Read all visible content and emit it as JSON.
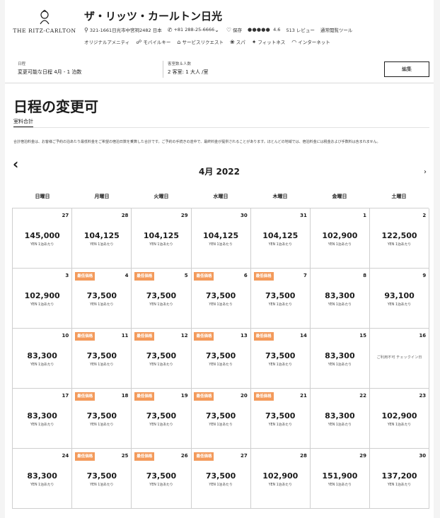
{
  "hotel": {
    "logo_text": "THE RITZ-CARLTON",
    "name": "ザ・リッツ・カールトン日光",
    "address": "321-1661日光市中宮祠2482 日本",
    "phone": "+81 288-25-6666",
    "save_label": "保存",
    "rating_dots": "●●●●●",
    "rating": "4.6",
    "reviews": "513 レビュー",
    "tab_detail": "通常閲覧ツール"
  },
  "amenities": [
    {
      "icon": "gift-icon",
      "glyph": "",
      "label": "オリジナルアメニティ"
    },
    {
      "icon": "mobile-key-icon",
      "glyph": "☍",
      "label": "モバイルキー"
    },
    {
      "icon": "service-bell-icon",
      "glyph": "⌂",
      "label": "サービスリクエスト"
    },
    {
      "icon": "spa-icon",
      "glyph": "❀",
      "label": "スパ"
    },
    {
      "icon": "fitness-icon",
      "glyph": "✦",
      "label": "フィットネス"
    },
    {
      "icon": "wifi-icon",
      "glyph": "◠",
      "label": "インターネット"
    }
  ],
  "search": {
    "date_label": "日程",
    "date_value": "変更可能な日程 4月 - 1 泊数",
    "guests_label": "客室数＆人数",
    "guests_value": "2 客室: 1 大人 /室",
    "edit_label": "編集"
  },
  "page": {
    "title": "日程の変更可",
    "tab": "室料合計",
    "note": "合計宿泊料金は、お客様ご予約の泊あたり最低料金をご希望の宿泊日数を乗算した合計です。ご予約の手続きの途中で、最終料金が提供されることがあります。ほとんどの地域では、宿泊料金には税金および手数料は含まれません。"
  },
  "calendar": {
    "month": "4月 2022",
    "weekdays": [
      "日曜日",
      "月曜日",
      "火曜日",
      "水曜日",
      "木曜日",
      "金曜日",
      "土曜日"
    ],
    "badge_label": "最低価格",
    "unit_label": "YEN 1泊あたり",
    "days": [
      {
        "day": "27",
        "price": "145,000",
        "badge": false
      },
      {
        "day": "28",
        "price": "104,125",
        "badge": false
      },
      {
        "day": "29",
        "price": "104,125",
        "badge": false
      },
      {
        "day": "30",
        "price": "104,125",
        "badge": false
      },
      {
        "day": "31",
        "price": "104,125",
        "badge": false
      },
      {
        "day": "1",
        "price": "102,900",
        "badge": false
      },
      {
        "day": "2",
        "price": "122,500",
        "badge": false
      },
      {
        "day": "3",
        "price": "102,900",
        "badge": false
      },
      {
        "day": "4",
        "price": "73,500",
        "badge": true
      },
      {
        "day": "5",
        "price": "73,500",
        "badge": true
      },
      {
        "day": "6",
        "price": "73,500",
        "badge": true
      },
      {
        "day": "7",
        "price": "73,500",
        "badge": true
      },
      {
        "day": "8",
        "price": "83,300",
        "badge": false
      },
      {
        "day": "9",
        "price": "93,100",
        "badge": false
      },
      {
        "day": "10",
        "price": "83,300",
        "badge": false
      },
      {
        "day": "11",
        "price": "73,500",
        "badge": true
      },
      {
        "day": "12",
        "price": "73,500",
        "badge": true
      },
      {
        "day": "13",
        "price": "73,500",
        "badge": true
      },
      {
        "day": "14",
        "price": "73,500",
        "badge": true
      },
      {
        "day": "15",
        "price": "83,300",
        "badge": false
      },
      {
        "day": "16",
        "price": "",
        "badge": false,
        "unavailable": "ご利用不可 チェックイン日"
      },
      {
        "day": "17",
        "price": "83,300",
        "badge": false
      },
      {
        "day": "18",
        "price": "73,500",
        "badge": true
      },
      {
        "day": "19",
        "price": "73,500",
        "badge": true
      },
      {
        "day": "20",
        "price": "73,500",
        "badge": true
      },
      {
        "day": "21",
        "price": "73,500",
        "badge": true
      },
      {
        "day": "22",
        "price": "83,300",
        "badge": false
      },
      {
        "day": "23",
        "price": "102,900",
        "badge": false
      },
      {
        "day": "24",
        "price": "83,300",
        "badge": false
      },
      {
        "day": "25",
        "price": "73,500",
        "badge": true
      },
      {
        "day": "26",
        "price": "73,500",
        "badge": true
      },
      {
        "day": "27",
        "price": "73,500",
        "badge": true
      },
      {
        "day": "28",
        "price": "102,900",
        "badge": false
      },
      {
        "day": "29",
        "price": "151,900",
        "badge": false
      },
      {
        "day": "30",
        "price": "137,200",
        "badge": false
      }
    ]
  },
  "colors": {
    "badge": "#f39a5b",
    "text": "#1c1c1c",
    "grid": "#cfcfcf"
  }
}
